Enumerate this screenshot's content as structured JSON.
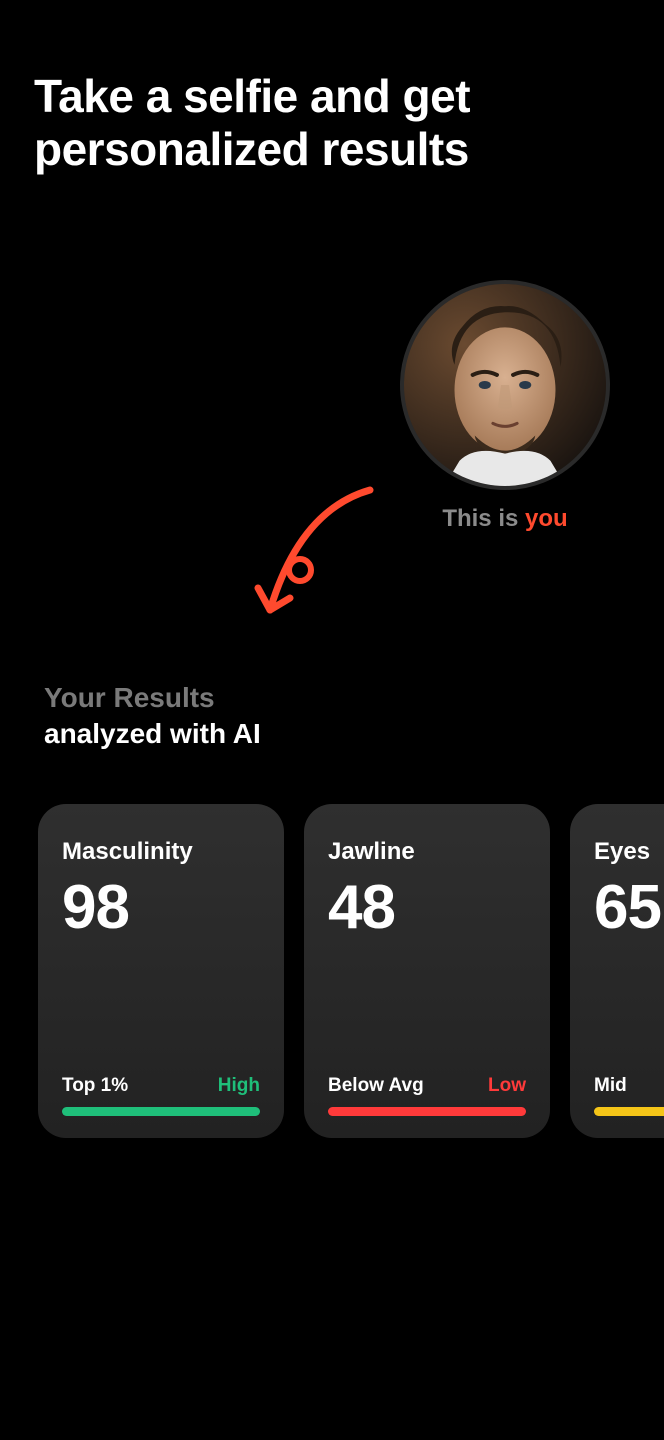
{
  "heading": "Take a selfie and get personalized results",
  "caption": {
    "prefix": "This is ",
    "highlight": "you"
  },
  "results_heading": {
    "line1": "Your Results",
    "line2": "analyzed with AI"
  },
  "cards": [
    {
      "title": "Masculinity",
      "score": "98",
      "rank": "Top 1%",
      "level": "High",
      "level_class": "high"
    },
    {
      "title": "Jawline",
      "score": "48",
      "rank": "Below Avg",
      "level": "Low",
      "level_class": "low"
    },
    {
      "title": "Eyes",
      "score": "65",
      "rank": "Mid",
      "level": "",
      "level_class": "mid"
    }
  ],
  "colors": {
    "accent": "#ff4a2e",
    "high": "#1fbf7a",
    "low": "#ff3a3a",
    "mid": "#f5c518"
  }
}
